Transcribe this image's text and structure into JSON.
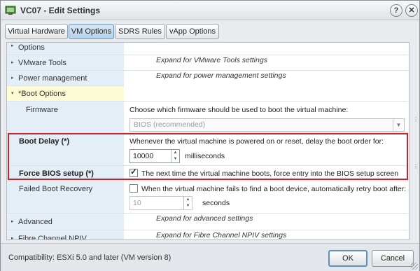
{
  "window": {
    "title": "VC07 - Edit Settings",
    "help_label": "?",
    "close_label": "✕"
  },
  "tabs": [
    {
      "label": "Virtual Hardware",
      "active": false
    },
    {
      "label": "VM Options",
      "active": true
    },
    {
      "label": "SDRS Rules",
      "active": false
    },
    {
      "label": "vApp Options",
      "active": false
    }
  ],
  "sections": {
    "options": {
      "label": "Options"
    },
    "vmware_tools": {
      "label": "VMware Tools",
      "desc": "Expand for VMware Tools settings"
    },
    "power": {
      "label": "Power management",
      "desc": "Expand for power management settings"
    },
    "boot_options": {
      "label": "*Boot Options"
    },
    "firmware": {
      "label": "Firmware",
      "desc": "Choose which firmware should be used to boot the virtual machine:",
      "selected": "BIOS (recommended)"
    },
    "boot_delay": {
      "label": "Boot Delay (*)",
      "desc": "Whenever the virtual machine is powered on or reset, delay the boot order for:",
      "value": "10000",
      "unit": "milliseconds"
    },
    "force_bios": {
      "label": "Force BIOS setup (*)",
      "checked": true,
      "desc": "The next time the virtual machine boots, force entry into the BIOS setup screen"
    },
    "failed_boot": {
      "label": "Failed Boot Recovery",
      "checked": false,
      "desc": "When the virtual machine fails to find a boot device, automatically retry boot after:",
      "value": "10",
      "unit": "seconds"
    },
    "advanced": {
      "label": "Advanced",
      "desc": "Expand for advanced settings"
    },
    "fibre": {
      "label": "Fibre Channel NPIV",
      "desc": "Expand for Fibre Channel NPIV settings"
    }
  },
  "footer": {
    "compatibility": "Compatibility: ESXi 5.0 and later (VM version 8)",
    "ok_label": "OK",
    "cancel_label": "Cancel"
  },
  "colors": {
    "highlight_border": "#c1272d",
    "active_tab": "#b6d2ec",
    "boot_header_bg": "#fdfbd4"
  }
}
